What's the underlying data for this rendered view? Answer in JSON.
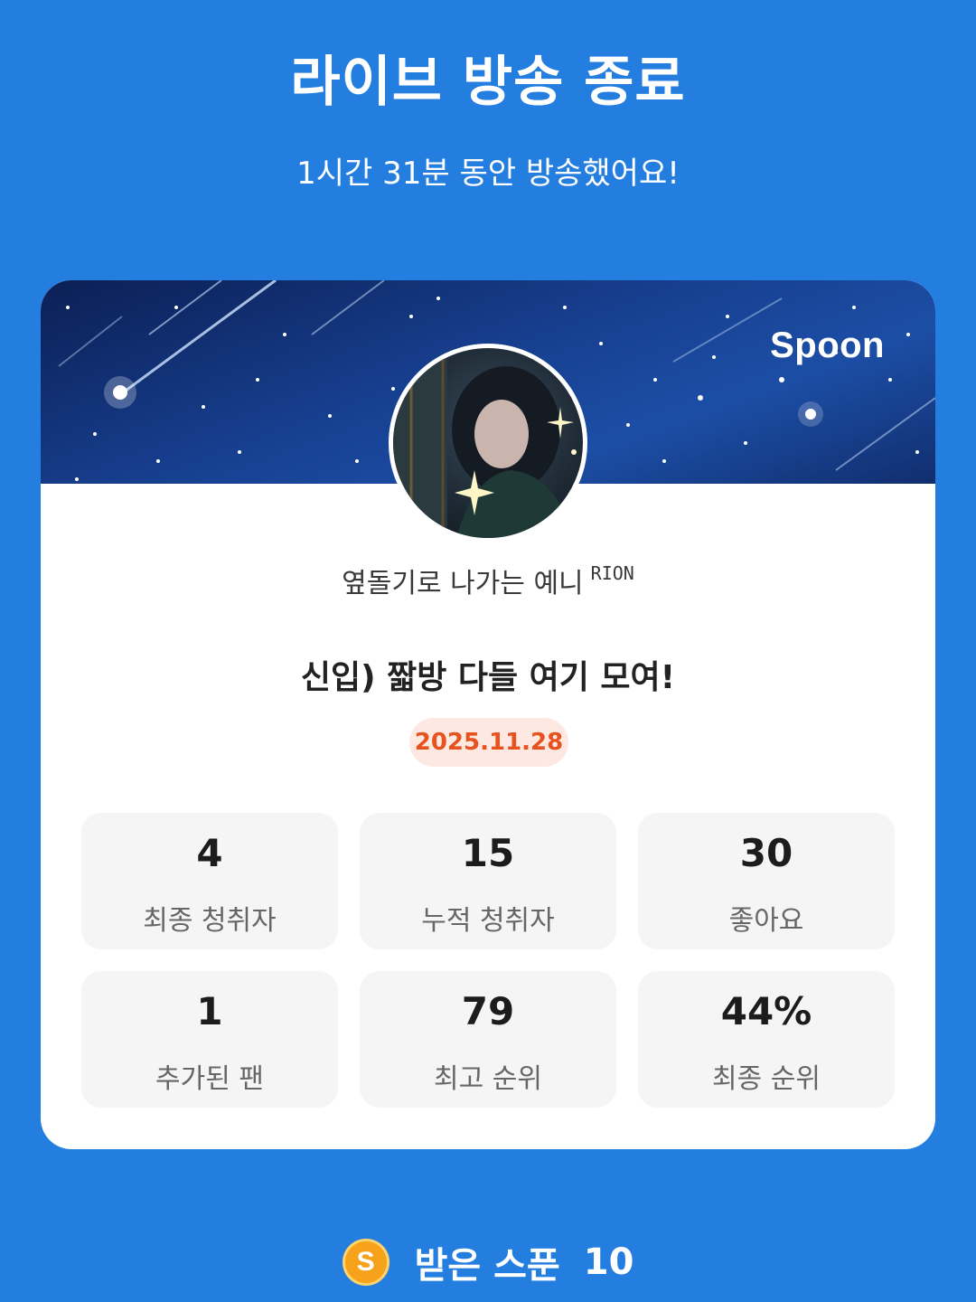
{
  "header": {
    "title": "라이브 방송 종료",
    "subtitle": "1시간 31분 동안 방송했어요!"
  },
  "card": {
    "brand": "Spoon",
    "host_name": "옆돌기로 나가는 예니",
    "host_tag": "RION",
    "broadcast_title": "신입) 짧방 다들 여기 모여!",
    "date": "2025.11.28",
    "date_color": "#e8521e",
    "stats": [
      {
        "value": "4",
        "label": "최종 청취자"
      },
      {
        "value": "15",
        "label": "누적 청취자"
      },
      {
        "value": "30",
        "label": "좋아요"
      },
      {
        "value": "1",
        "label": "추가된 팬"
      },
      {
        "value": "79",
        "label": "최고 순위"
      },
      {
        "value": "44%",
        "label": "최종 순위"
      }
    ]
  },
  "footer": {
    "coin_icon": "spoon-coin-icon",
    "coin_letter": "S",
    "label": "받은 스푼",
    "value": "10"
  },
  "colors": {
    "background": "#247ee0",
    "card": "#ffffff",
    "tile": "#f5f5f5"
  }
}
